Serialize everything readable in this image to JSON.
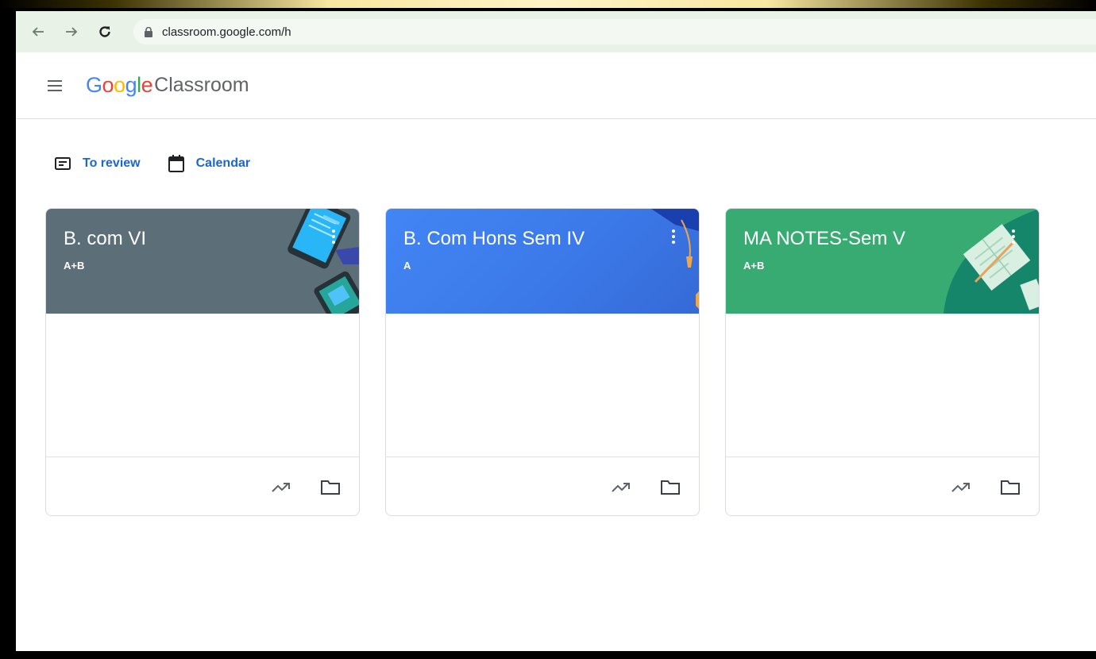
{
  "browser": {
    "url": "classroom.google.com/h"
  },
  "app": {
    "logo_text": "Google",
    "product_name": "Classroom"
  },
  "shortcuts": [
    {
      "label": "To review",
      "icon": "to-review-icon"
    },
    {
      "label": "Calendar",
      "icon": "calendar-icon"
    }
  ],
  "cards": [
    {
      "title": "B. com VI",
      "section": "A+B",
      "color": "#5c6f79"
    },
    {
      "title": "B. Com Hons Sem IV",
      "section": "A",
      "color": "#3f7ee8"
    },
    {
      "title": "MA NOTES-Sem V",
      "section": "A+B",
      "color": "#37ab72"
    }
  ],
  "colors": {
    "accent": "#1967d2",
    "browser_bar": "#e9f2e6"
  }
}
